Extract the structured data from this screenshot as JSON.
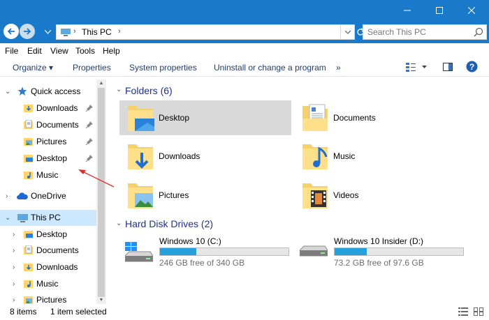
{
  "window": {
    "minimize_icon": "minimize-icon",
    "maximize_icon": "maximize-icon",
    "close_icon": "close-icon",
    "accent": "#1979ca"
  },
  "address": {
    "path": "This PC",
    "search_placeholder": "Search This PC"
  },
  "menu": [
    "File",
    "Edit",
    "View",
    "Tools",
    "Help"
  ],
  "commands": {
    "organize": "Organize ▾",
    "properties": "Properties",
    "system_properties": "System properties",
    "uninstall": "Uninstall or change a program",
    "more": "»"
  },
  "nav": {
    "quick_access": "Quick access",
    "quick_items": [
      "Downloads",
      "Documents",
      "Pictures",
      "Desktop",
      "Music"
    ],
    "onedrive": "OneDrive",
    "this_pc": "This PC",
    "pc_items": [
      "Desktop",
      "Documents",
      "Downloads",
      "Music",
      "Pictures"
    ]
  },
  "content": {
    "folders_header": "Folders (6)",
    "folders": [
      "Desktop",
      "Documents",
      "Downloads",
      "Music",
      "Pictures",
      "Videos"
    ],
    "drives_header": "Hard Disk Drives (2)",
    "drives": [
      {
        "name": "Windows 10 (C:)",
        "free": "246 GB free of 340 GB",
        "used_fraction": 0.28
      },
      {
        "name": "Windows 10 Insider (D:)",
        "free": "73.2 GB free of 97.6 GB",
        "used_fraction": 0.25
      }
    ]
  },
  "status": {
    "items": "8 items",
    "selected": "1 item selected"
  }
}
